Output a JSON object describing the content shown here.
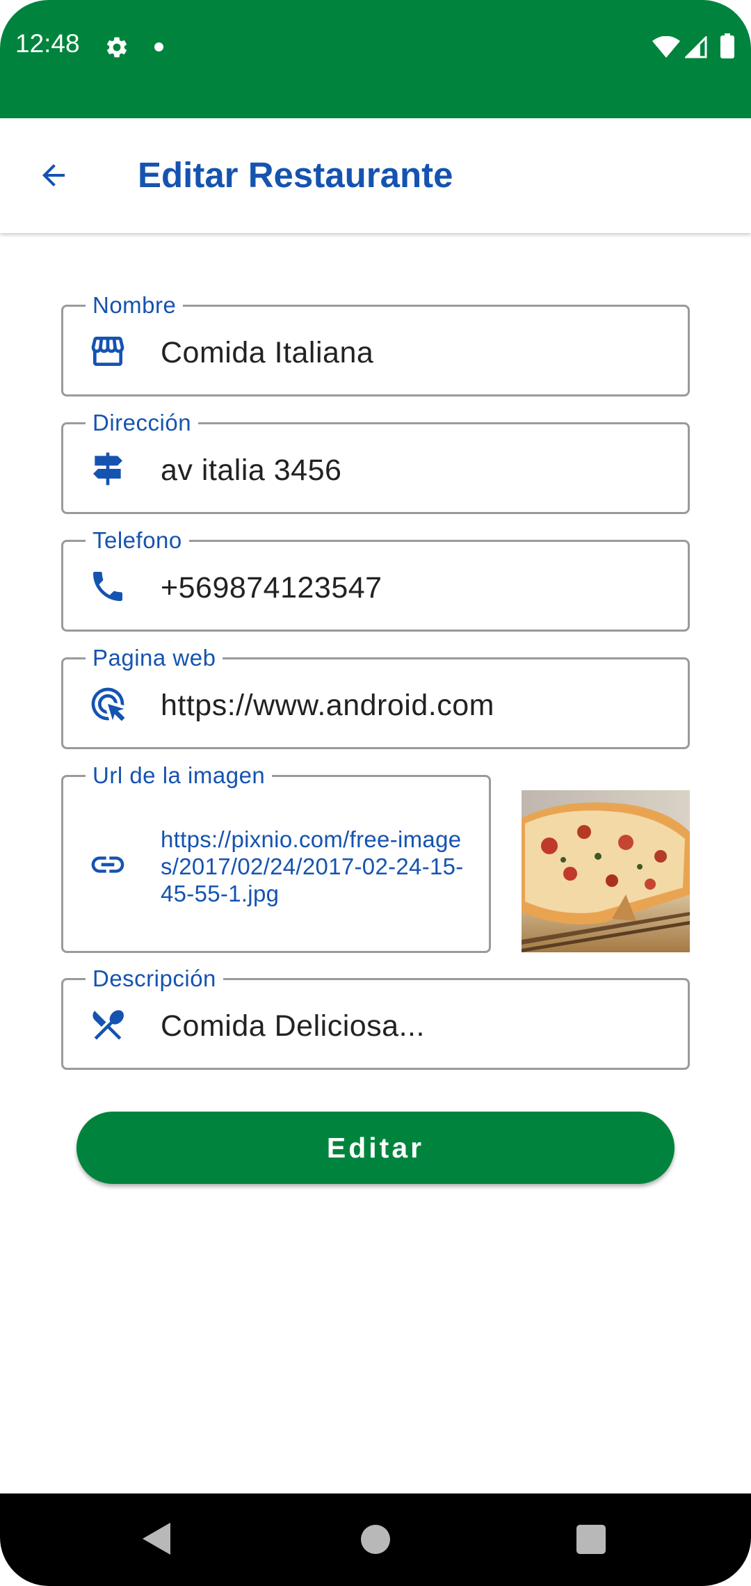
{
  "status_bar": {
    "time": "12:48"
  },
  "app_bar": {
    "title": "Editar Restaurante"
  },
  "form": {
    "nombre": {
      "label": "Nombre",
      "value": "Comida Italiana",
      "icon": "storefront-icon"
    },
    "direccion": {
      "label": "Dirección",
      "value": "av italia 3456",
      "icon": "signpost-icon"
    },
    "telefono": {
      "label": "Telefono",
      "value": "+569874123547",
      "icon": "phone-icon"
    },
    "pagina_web": {
      "label": "Pagina web",
      "value": "https://www.android.com",
      "icon": "ads-click-icon"
    },
    "url_imagen": {
      "label": "Url de la imagen",
      "value": "https://pixnio.com/free-images/2017/02/24/2017-02-24-15-45-55-1.jpg",
      "icon": "link-icon"
    },
    "descripcion": {
      "label": "Descripción",
      "value": "Comida Deliciosa...",
      "icon": "restaurant-icon"
    }
  },
  "submit": {
    "label": "Editar"
  },
  "colors": {
    "primary": "#00843d",
    "accent": "#1553b0"
  }
}
